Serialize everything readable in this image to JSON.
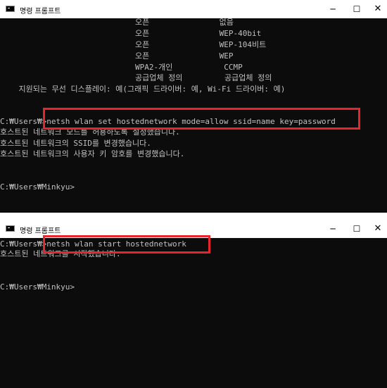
{
  "window1": {
    "title": "명령 프롬프트",
    "controls": {
      "minimize": "─",
      "maximize": "☐",
      "close": "✕"
    },
    "lines": [
      "                             오픈               없음",
      "                             오픈               WEP-40bit",
      "                             오픈               WEP-104비트",
      "                             오픈               WEP",
      "                             WPA2-개인           CCMP",
      "                             공급업체 정의         공급업체 정의",
      "    지원되는 무선 디스플레이: 예(그래픽 드라이버: 예, Wi-Fi 드라이버: 예)",
      "",
      "C:₩Users₩>netsh wlan set hostednetwork mode=allow ssid=name key=password",
      "호스트된 네트워크 모드를 허용하도록 설정했습니다.",
      "호스트된 네트워크의 SSID를 변경했습니다.",
      "호스트된 네트워크의 사용자 키 암호를 변경했습니다.",
      "",
      "",
      "C:₩Users₩Minkyu>"
    ]
  },
  "window2": {
    "title": "명령 프롬프트",
    "controls": {
      "minimize": "─",
      "maximize": "☐",
      "close": "✕"
    },
    "lines": [
      "C:₩Users₩>netsh wlan start hostednetwork",
      "호스트된 네트워크를 시작했습니다.",
      "",
      "",
      "C:₩Users₩Minkyu>"
    ]
  },
  "colors": {
    "highlight": "#e8242c",
    "console_bg": "#0c0c0c",
    "console_text": "#c0c0c0"
  }
}
